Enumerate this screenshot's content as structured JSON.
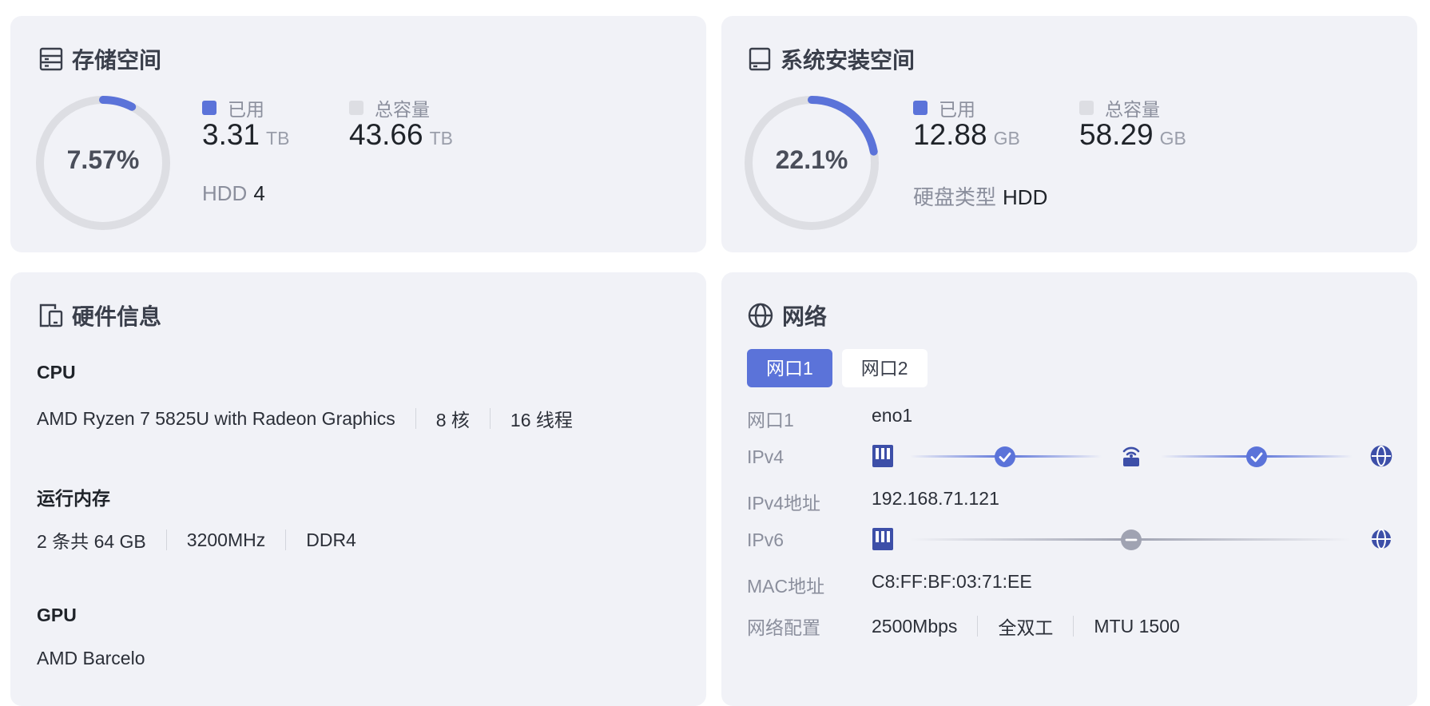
{
  "storage": {
    "title": "存储空间",
    "icon": "storage-icon",
    "percent_label": "7.57%",
    "percent_value": 7.57,
    "used_label": "已用",
    "used_value": "3.31",
    "used_unit": "TB",
    "total_label": "总容量",
    "total_value": "43.66",
    "total_unit": "TB",
    "disk_key": "HDD",
    "disk_value": "4"
  },
  "system_storage": {
    "title": "系统安装空间",
    "icon": "drive-icon",
    "percent_label": "22.1%",
    "percent_value": 22.1,
    "used_label": "已用",
    "used_value": "12.88",
    "used_unit": "GB",
    "total_label": "总容量",
    "total_value": "58.29",
    "total_unit": "GB",
    "disk_key": "硬盘类型",
    "disk_value": "HDD"
  },
  "hardware": {
    "title": "硬件信息",
    "icon": "devices-icon",
    "cpu_heading": "CPU",
    "cpu_items": [
      "AMD Ryzen 7 5825U with Radeon Graphics",
      "8 核",
      "16 线程"
    ],
    "mem_heading": "运行内存",
    "mem_items": [
      "2 条共 64 GB",
      "3200MHz",
      "DDR4"
    ],
    "gpu_heading": "GPU",
    "gpu_items": [
      "AMD Barcelo"
    ]
  },
  "network": {
    "title": "网络",
    "icon": "globe-icon",
    "tabs": [
      "网口1",
      "网口2"
    ],
    "active_tab": 0,
    "rows": {
      "port_key": "网口1",
      "port_value": "eno1",
      "ipv4_key": "IPv4",
      "ipv4_addr_key": "IPv4地址",
      "ipv4_addr_value": "192.168.71.121",
      "ipv6_key": "IPv6",
      "mac_key": "MAC地址",
      "mac_value": "C8:FF:BF:03:71:EE",
      "config_key": "网络配置",
      "config_items": [
        "2500Mbps",
        "全双工",
        "MTU 1500"
      ]
    }
  },
  "colors": {
    "accent": "#5b73d9",
    "ring_track": "#dddee3",
    "card_bg": "#f1f2f7",
    "muted": "#8b8f9d"
  }
}
